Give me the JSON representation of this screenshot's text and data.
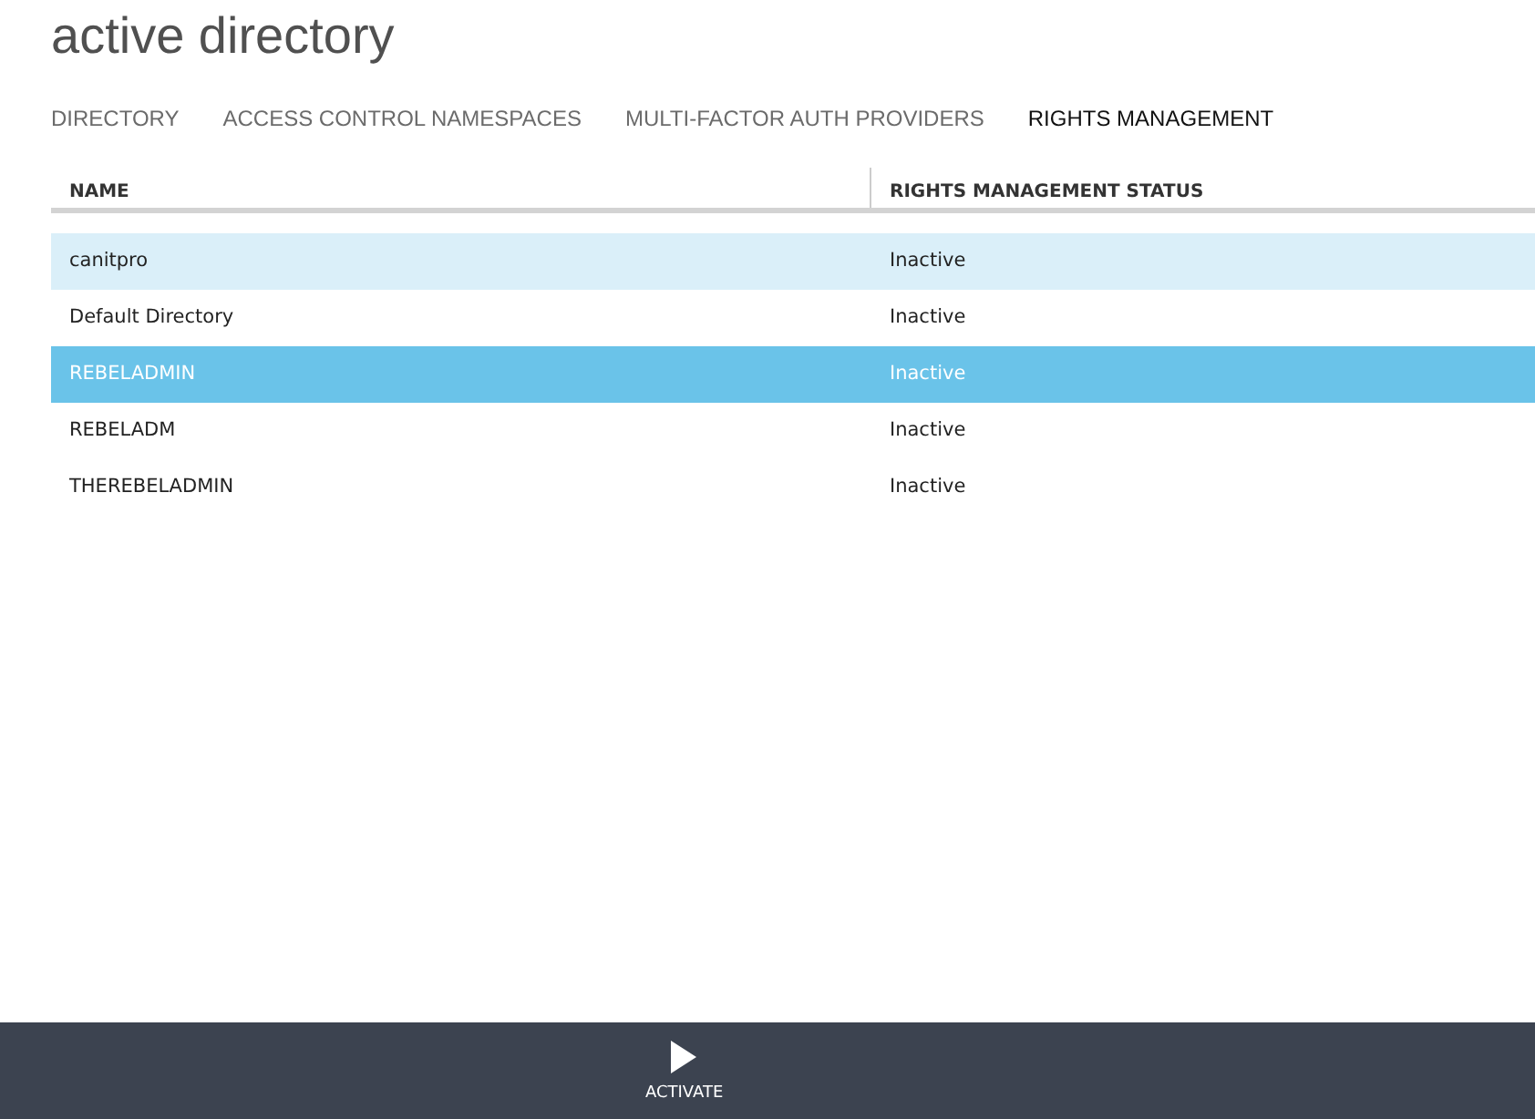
{
  "page": {
    "title": "active directory"
  },
  "tabs": [
    {
      "label": "DIRECTORY",
      "selected": false
    },
    {
      "label": "ACCESS CONTROL NAMESPACES",
      "selected": false
    },
    {
      "label": "MULTI-FACTOR AUTH PROVIDERS",
      "selected": false
    },
    {
      "label": "RIGHTS MANAGEMENT",
      "selected": true
    }
  ],
  "table": {
    "columns": [
      "NAME",
      "RIGHTS MANAGEMENT STATUS"
    ],
    "rows": [
      {
        "cells": [
          "canitpro",
          "Inactive"
        ],
        "selected": false,
        "hovered": true
      },
      {
        "cells": [
          "Default Directory",
          "Inactive"
        ],
        "selected": false,
        "hovered": false
      },
      {
        "cells": [
          "REBELADMIN",
          "Inactive"
        ],
        "selected": true,
        "hovered": false
      },
      {
        "cells": [
          "REBELADM",
          "Inactive"
        ],
        "selected": false,
        "hovered": false
      },
      {
        "cells": [
          "THEREBELADMIN",
          "Inactive"
        ],
        "selected": false,
        "hovered": false
      }
    ]
  },
  "command_bar": {
    "buttons": [
      {
        "label": "ACTIVATE",
        "kind": "play"
      }
    ]
  }
}
